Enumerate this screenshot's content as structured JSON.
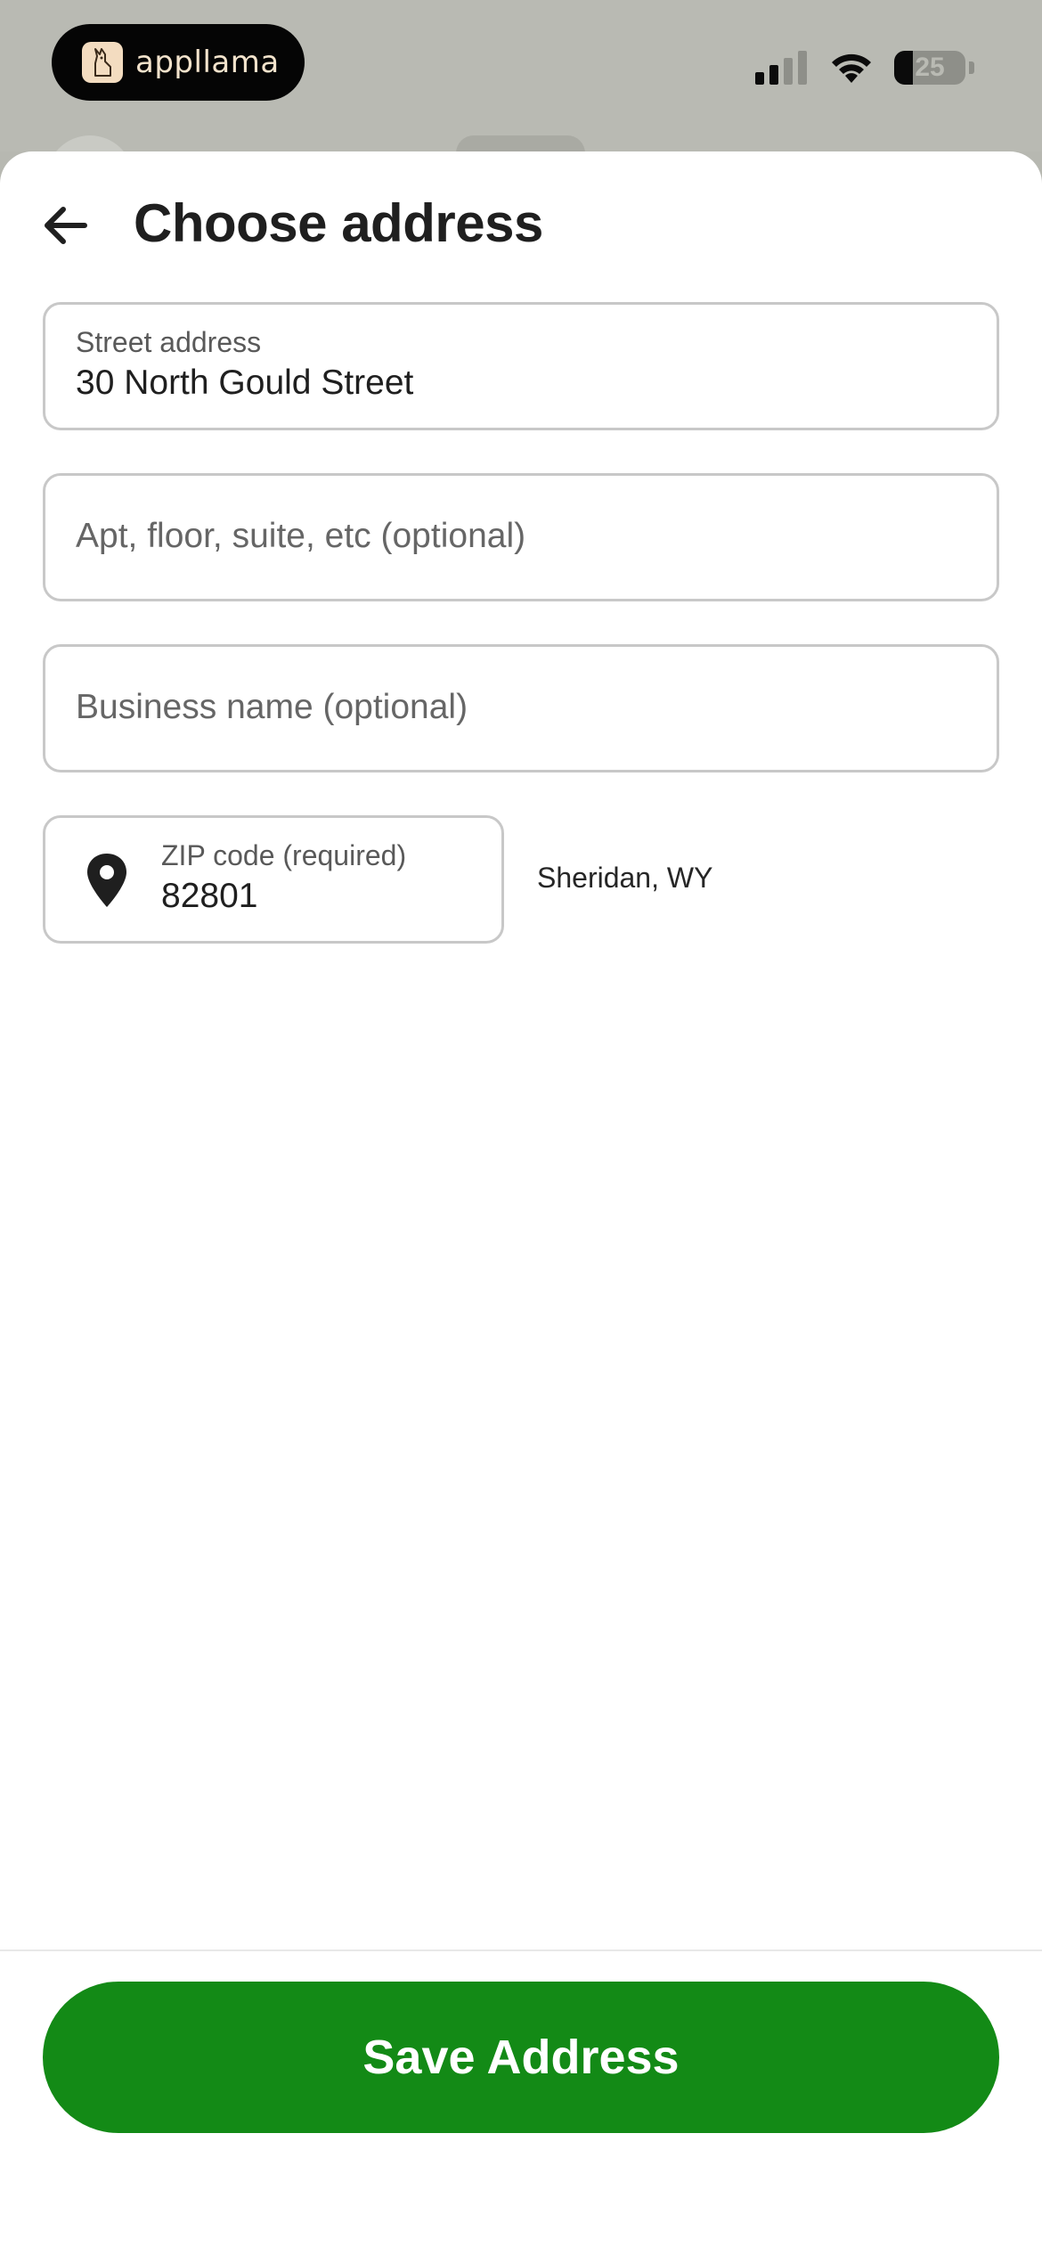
{
  "status_bar": {
    "app_name": "appllama",
    "battery_percent": "25",
    "icons": [
      "signal-icon",
      "wifi-icon",
      "battery-icon"
    ]
  },
  "header": {
    "back_icon": "arrow-left-icon",
    "title": "Choose address"
  },
  "form": {
    "street": {
      "label": "Street address",
      "value": "30 North Gould Street"
    },
    "apt": {
      "placeholder": "Apt, floor, suite, etc (optional)"
    },
    "business": {
      "placeholder": "Business name (optional)"
    },
    "zip": {
      "icon": "location-pin-icon",
      "label": "ZIP code (required)",
      "value": "82801",
      "city": "Sheridan, WY"
    }
  },
  "footer": {
    "save_label": "Save Address"
  },
  "colors": {
    "primary_button": "#138a16",
    "field_border": "#c8c8c8",
    "text_primary": "#1f1f1f"
  }
}
